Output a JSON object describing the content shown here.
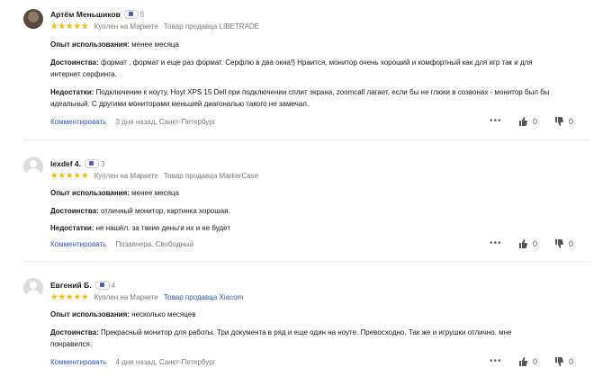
{
  "reviews": [
    {
      "name": "Артём Меньшиков",
      "level": "5",
      "stars": "★★★★★",
      "purchase": "Куплен на Маркете",
      "seller": "Товар продавца LIBETRADE",
      "usage_label": "Опыт использования:",
      "usage": "менее месяца",
      "pros_label": "Достоинства:",
      "pros_line1": "формат , формат и еще раз формат. Серфлю в два окна!) Нраится, монитор очень хороший и комфортный как для игр так и для",
      "pros_line2": "интернет серфинга.",
      "cons_label": "Недостатки:",
      "cons_line1": "Подключение к ноуту, Hoyt XPS 15 Dell при подключении сплит экрана, zoomcall лагает, если бы не глюки в созвонах - монитор был бы",
      "cons_line2": "идеальный. С другими мониторами меньшей диагональю такого не замечал.",
      "comment_label": "Комментировать",
      "meta": "3 дня назад, Санкт-Петербург",
      "likes": "0",
      "dislikes": "0"
    },
    {
      "name": "lexdef 4.",
      "level": "3",
      "stars": "★★★★★",
      "purchase": "Куплен на Маркете",
      "seller": "Товар продавца MarkerCase",
      "usage_label": "Опыт использования:",
      "usage": "менее месяца",
      "pros_label": "Достоинства:",
      "pros_line1": "отличный монитор, картинка хорошая.",
      "cons_label": "Недостатки:",
      "cons_line1": "не нашёл. за такие деньги их и не будет",
      "comment_label": "Комментировать",
      "meta": "Позавчера, Свободный",
      "likes": "0",
      "dislikes": "0"
    },
    {
      "name": "Евгений Б.",
      "level": "4",
      "stars": "★★★★★",
      "purchase": "Куплен на Маркете",
      "seller": "Товар продавца Xiacom",
      "usage_label": "Опыт использования:",
      "usage": "несколько месяцев",
      "pros_label": "Достоинства:",
      "pros_line1": "Прекрасный монитор для работы. Три документа в ряд и еще один на ноуте. Превосходно. Так же и игрушки отлично. мне",
      "pros_line2": "понравился.",
      "comment_label": "Комментировать",
      "meta": "4 дня назад, Санкт-Петербург",
      "likes": "0",
      "dislikes": "0"
    }
  ],
  "colors": {
    "star": "#fcb900",
    "link": "#3353bf",
    "muted": "#7a7a7a"
  },
  "icons": [
    "avatar",
    "level-badge-icon",
    "star-icon",
    "more-dots-icon",
    "thumb-up-icon",
    "thumb-down-icon"
  ]
}
